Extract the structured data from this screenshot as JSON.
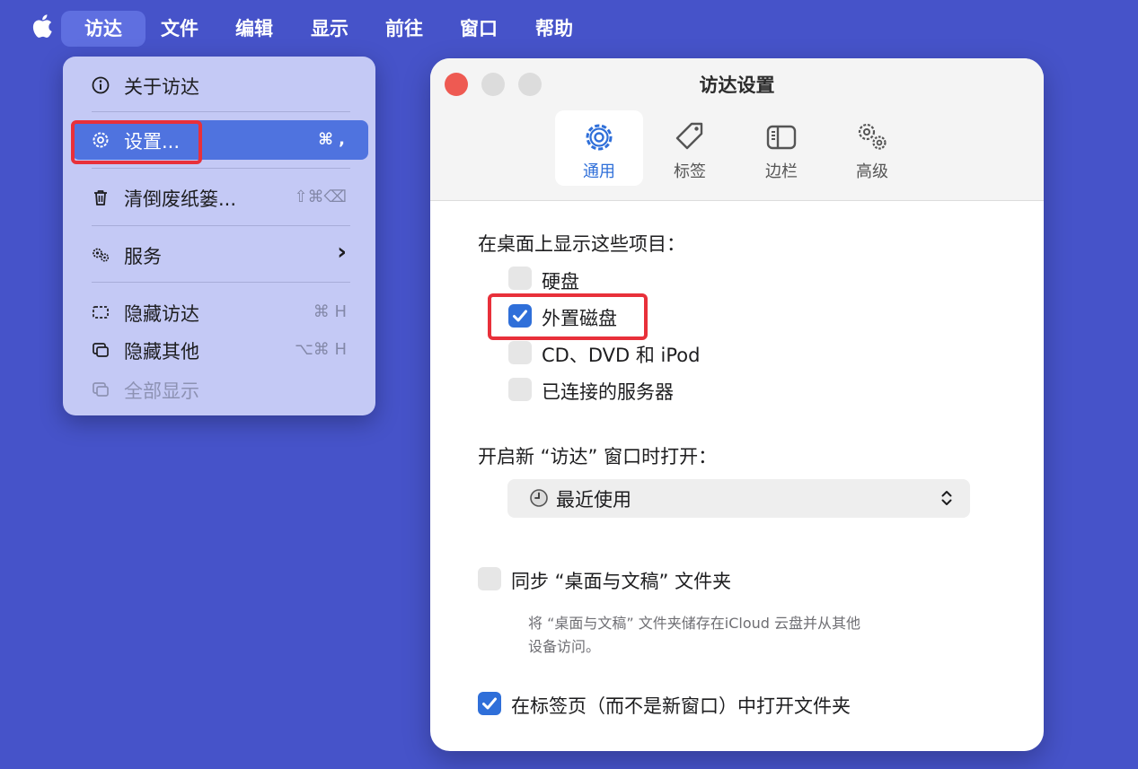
{
  "menubar": {
    "apple_icon": "apple-logo-icon",
    "items": [
      "访达",
      "文件",
      "编辑",
      "显示",
      "前往",
      "窗口",
      "帮助"
    ]
  },
  "finder_menu": {
    "about": "关于访达",
    "settings": {
      "label": "设置...",
      "shortcut": "⌘ ,"
    },
    "empty_trash": {
      "label": "清倒废纸篓...",
      "shortcut": "⇧⌘⌫"
    },
    "services": {
      "label": "服务",
      "arrow": "›"
    },
    "hide_finder": {
      "label": "隐藏访达",
      "shortcut": "⌘ H"
    },
    "hide_others": {
      "label": "隐藏其他",
      "shortcut": "⌥⌘ H"
    },
    "show_all": {
      "label": "全部显示"
    }
  },
  "settings_window": {
    "title": "访达设置",
    "tabs": [
      {
        "label": "通用",
        "icon": "gear-icon",
        "selected": true
      },
      {
        "label": "标签",
        "icon": "tag-icon",
        "selected": false
      },
      {
        "label": "边栏",
        "icon": "sidebar-icon",
        "selected": false
      },
      {
        "label": "高级",
        "icon": "gears-icon",
        "selected": false
      }
    ],
    "desktop_section_title": "在桌面上显示这些项目：",
    "desktop_items": [
      {
        "label": "硬盘",
        "checked": false
      },
      {
        "label": "外置磁盘",
        "checked": true
      },
      {
        "label": "CD、DVD 和 iPod",
        "checked": false
      },
      {
        "label": "已连接的服务器",
        "checked": false
      }
    ],
    "new_window_label": "开启新 “访达” 窗口时打开：",
    "new_window_value": "最近使用",
    "sync_label": "同步 “桌面与文稿” 文件夹",
    "sync_checked": false,
    "sync_note_line1": "将 “桌面与文稿” 文件夹储存在iCloud 云盘并从其他",
    "sync_note_line2": "设备访问。",
    "tabs_label": "在标签页（而不是新窗口）中打开文件夹",
    "tabs_checked": true
  },
  "colors": {
    "desktop": "#4653c9",
    "accent": "#2f6fd9",
    "highlight_box": "#e8303a",
    "close": "#ee5a52"
  }
}
